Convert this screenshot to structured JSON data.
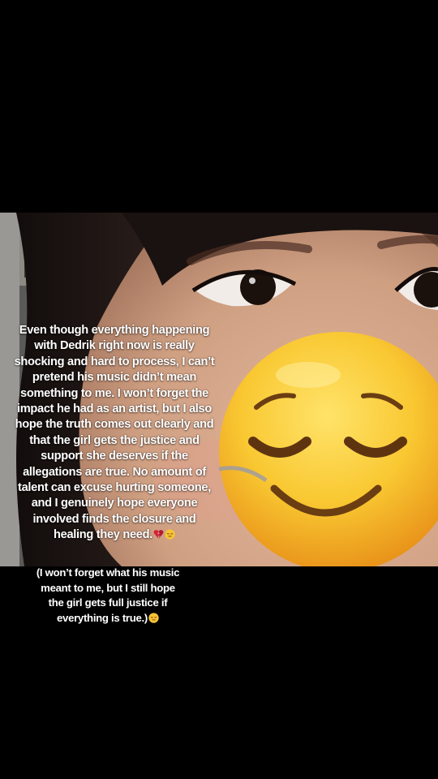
{
  "post": {
    "caption_main": "Even though everything happening with Dedrik right now is really shocking and hard to process, I can’t pretend his music didn’t mean something to me. I won’t forget the impact he had as an artist, but I also hope the truth comes out clearly and that the girl gets the justice and support she deserves if the allegations are true. No amount of talent can excuse hurting someone, and I genuinely hope everyone involved finds the closure and healing they need.",
    "caption_main_emojis": [
      "broken-heart-emoji",
      "pensive-face-emoji"
    ],
    "caption_sub": "(I won’t forget what his music meant to me, but I still hope the girl gets full justice if everything is true.)",
    "caption_sub_emojis": [
      "pensive-face-emoji"
    ],
    "sticker": "relieved-face-emoji"
  },
  "colors": {
    "background": "#000000",
    "text": "#ffffff",
    "emoji_yellow": "#f6c432",
    "emoji_dark": "#6b3d12"
  }
}
